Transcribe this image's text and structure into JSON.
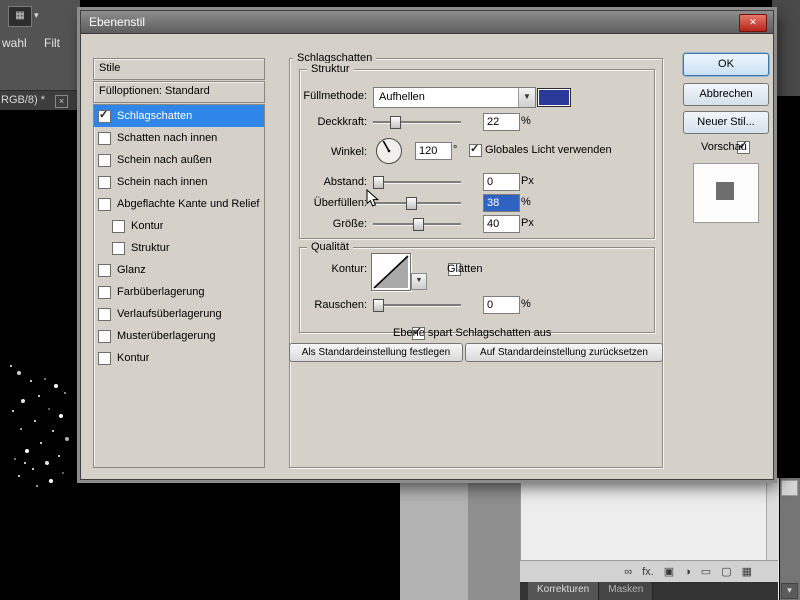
{
  "app": {
    "menu": [
      "wahl",
      "Filt"
    ],
    "doc_tab": "RGB/8) *",
    "panel_tabs": [
      "Korrekturen",
      "Masken"
    ],
    "bottom_icons": [
      {
        "name": "link-layers-icon",
        "glyph": "∞"
      },
      {
        "name": "layer-effects-icon",
        "glyph": "fx."
      },
      {
        "name": "layer-mask-icon",
        "glyph": "▣"
      },
      {
        "name": "adjustment-layer-icon",
        "glyph": "◑"
      },
      {
        "name": "layer-group-icon",
        "glyph": "▭"
      },
      {
        "name": "new-layer-icon",
        "glyph": "▢"
      },
      {
        "name": "delete-layer-icon",
        "glyph": "▦"
      }
    ]
  },
  "icons": {
    "close": "✕",
    "tab_close": "×",
    "dropdown_arrow": "▼",
    "check": "✓",
    "caret": "▾",
    "scroll_down": "▾",
    "app_glyph": "▦"
  },
  "dialog": {
    "title": "Ebenenstil"
  },
  "styles": {
    "header": "Stile",
    "fill_options": "Fülloptionen: Standard",
    "items": [
      {
        "label": "Schlagschatten",
        "checked": true,
        "selected": true
      },
      {
        "label": "Schatten nach innen",
        "checked": false
      },
      {
        "label": "Schein nach außen",
        "checked": false
      },
      {
        "label": "Schein nach innen",
        "checked": false
      },
      {
        "label": "Abgeflachte Kante und Relief",
        "checked": false
      },
      {
        "label": "Kontur",
        "checked": false,
        "indent": true
      },
      {
        "label": "Struktur",
        "checked": false,
        "indent": true
      },
      {
        "label": "Glanz",
        "checked": false
      },
      {
        "label": "Farbüberlagerung",
        "checked": false
      },
      {
        "label": "Verlaufsüberlagerung",
        "checked": false
      },
      {
        "label": "Musterüberlagerung",
        "checked": false
      },
      {
        "label": "Kontur",
        "checked": false
      }
    ]
  },
  "main": {
    "title": "Schlagschatten",
    "struct": {
      "legend": "Struktur",
      "blend_label": "Füllmethode:",
      "blend_value": "Aufhellen",
      "shadow_color": "#2b3a99",
      "opacity_label": "Deckkraft:",
      "opacity_value": "22",
      "opacity_unit": "%",
      "angle_label": "Winkel:",
      "angle_value": "120",
      "angle_unit": "°",
      "global_light": "Globales Licht verwenden",
      "distance_label": "Abstand:",
      "distance_value": "0",
      "distance_unit": "Px",
      "spread_label": "Überfüllen:",
      "spread_value": "38",
      "spread_unit": "%",
      "size_label": "Größe:",
      "size_value": "40",
      "size_unit": "Px"
    },
    "quality": {
      "legend": "Qualität",
      "contour_label": "Kontur:",
      "antialias": "Glätten",
      "noise_label": "Rauschen:",
      "noise_value": "0",
      "noise_unit": "%"
    },
    "knockout": "Ebene spart Schlagschatten aus",
    "make_default": "Als Standardeinstellung festlegen",
    "reset_default": "Auf Standardeinstellung zurücksetzen"
  },
  "actions": {
    "ok": "OK",
    "cancel": "Abbrechen",
    "new_style": "Neuer Stil...",
    "preview": "Vorschau"
  },
  "colors": {
    "selection_blue": "#2f86e8",
    "swatch_blue": "#2b3a99",
    "dialog_bg": "#d5d1c9"
  }
}
